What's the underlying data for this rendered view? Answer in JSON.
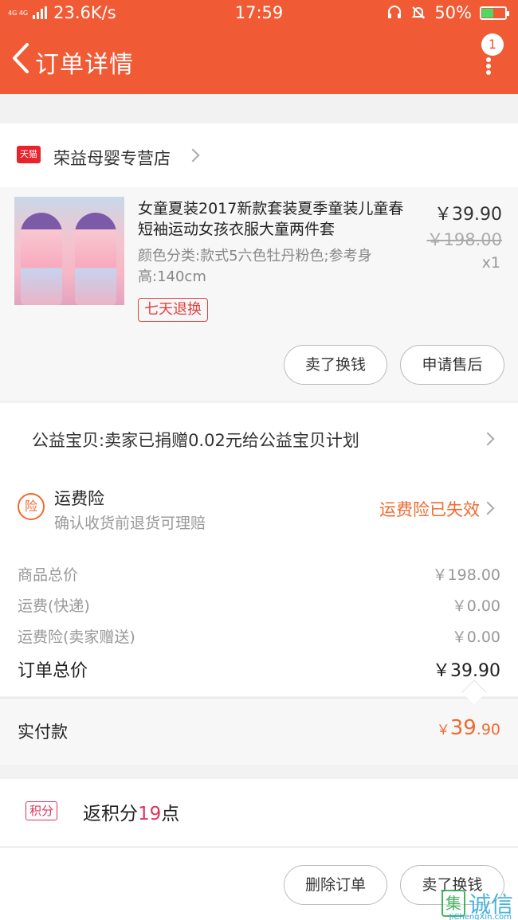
{
  "status_bar": {
    "network": "4G 4G",
    "speed": "23.6K/s",
    "time": "17:59",
    "battery": "50%",
    "battery_level": 0.5,
    "icons": [
      "headset-icon",
      "bell-muted-icon",
      "battery-charging-icon"
    ]
  },
  "header": {
    "title": "订单详情",
    "back_icon": "chevron-left-icon",
    "more_icon": "more-vertical-icon",
    "badge": "1"
  },
  "store": {
    "badge": "天猫",
    "name": "荣益母婴专营店"
  },
  "product": {
    "title": "女童夏装2017新款套装夏季童装儿童春短袖运动女孩衣服大童两件套",
    "sku": "颜色分类:款式5六色牡丹粉色;参考身高:140cm",
    "tag": "七天退换",
    "price": "￥39.90",
    "original_price": "￥198.00",
    "quantity": "x1",
    "buttons": [
      "卖了换钱",
      "申请售后"
    ]
  },
  "charity": {
    "text": "公益宝贝:卖家已捐赠0.02元给公益宝贝计划"
  },
  "insurance": {
    "icon_text": "险",
    "title": "运费险",
    "subtitle": "确认收货前退货可理赔",
    "status": "运费险已失效"
  },
  "summary": {
    "rows": [
      {
        "label": "商品总价",
        "value": "￥198.00"
      },
      {
        "label": "运费(快递)",
        "value": "￥0.00"
      },
      {
        "label": "运费险(卖家赠送)",
        "value": "￥0.00"
      }
    ],
    "total_label": "订单总价",
    "total_value": "￥39.90"
  },
  "payment": {
    "label": "实付款",
    "currency": "￥",
    "integer": "39",
    "decimal": ".90"
  },
  "points": {
    "tag": "积分",
    "prefix": "返积分",
    "value": "19",
    "suffix": "点"
  },
  "bottom_actions": [
    "删除订单",
    "卖了换钱"
  ],
  "watermark": {
    "icon_text": "集",
    "text": "诚信",
    "url": "JiChengXin.com"
  },
  "colors": {
    "header_bg": "#f05b35",
    "accent_orange": "#f06a30",
    "accent_red": "#e34040",
    "points_pink": "#e3315a"
  }
}
